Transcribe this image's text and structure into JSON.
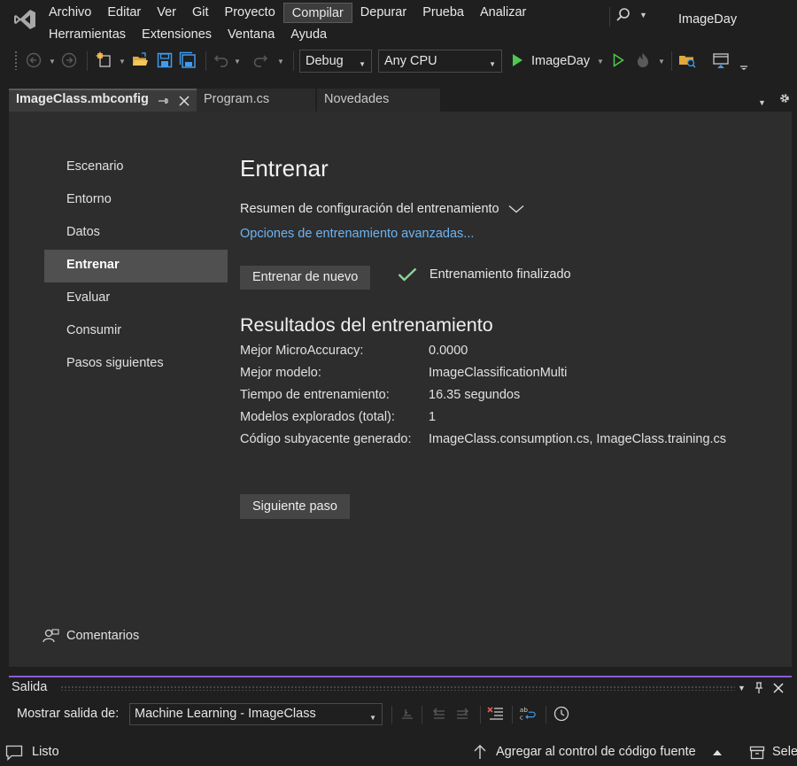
{
  "menu": {
    "row1": [
      "Archivo",
      "Editar",
      "Ver",
      "Git",
      "Proyecto",
      "Compilar",
      "Depurar",
      "Prueba",
      "Analizar"
    ],
    "row2": [
      "Herramientas",
      "Extensiones",
      "Ventana",
      "Ayuda"
    ],
    "active": "Compilar"
  },
  "solution_name": "ImageDay",
  "toolbar": {
    "configuration": "Debug",
    "platform": "Any CPU",
    "startup_project": "ImageDay",
    "play_color": "#4ec94e"
  },
  "tabs": [
    {
      "label": "ImageClass.mbconfig",
      "active": true
    },
    {
      "label": "Program.cs",
      "active": false
    },
    {
      "label": "Novedades",
      "active": false
    }
  ],
  "nav": {
    "items": [
      "Escenario",
      "Entorno",
      "Datos",
      "Entrenar",
      "Evaluar",
      "Consumir",
      "Pasos siguientes"
    ],
    "selected": "Entrenar",
    "feedback": "Comentarios"
  },
  "train": {
    "title": "Entrenar",
    "summary": "Resumen de configuración del entrenamiento",
    "advanced_link": "Opciones de entrenamiento avanzadas...",
    "retrain_button": "Entrenar de nuevo",
    "status": "Entrenamiento finalizado",
    "results_title": "Resultados del entrenamiento",
    "results": [
      {
        "key": "Mejor MicroAccuracy:",
        "value": "0.0000"
      },
      {
        "key": "Mejor modelo:",
        "value": "ImageClassificationMulti"
      },
      {
        "key": "Tiempo de entrenamiento:",
        "value": "16.35 segundos"
      },
      {
        "key": "Modelos explorados (total):",
        "value": "1"
      },
      {
        "key": "Código subyacente generado:",
        "value": "ImageClass.consumption.cs, ImageClass.training.cs"
      }
    ],
    "next_button": "Siguiente paso",
    "link_color": "#6cb4f5"
  },
  "output": {
    "title": "Salida",
    "show_label": "Mostrar salida de:",
    "source": "Machine Learning - ImageClass",
    "accent": "#8a5cd6"
  },
  "statusbar": {
    "status": "Listo",
    "source_control": "Agregar al control de código fuente",
    "select": "Sele"
  }
}
